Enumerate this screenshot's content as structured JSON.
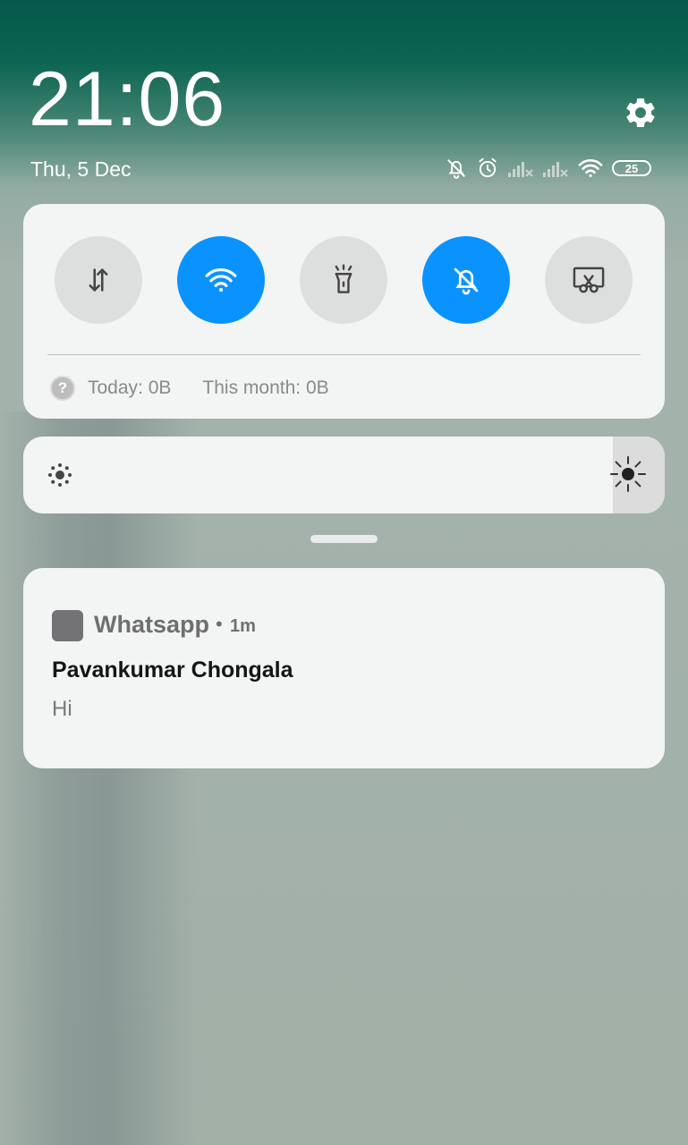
{
  "status": {
    "time": "21:06",
    "date": "Thu, 5 Dec",
    "battery": "25",
    "icons": [
      "bell-off-icon",
      "alarm-icon",
      "signal-off-icon",
      "signal-off-icon",
      "wifi-icon"
    ]
  },
  "header": {
    "settings_icon": "gear-icon"
  },
  "quick_settings": {
    "toggles": [
      {
        "name": "mobile-data",
        "icon": "data-arrows-icon",
        "state": "off"
      },
      {
        "name": "wifi",
        "icon": "wifi-icon",
        "state": "on"
      },
      {
        "name": "flashlight",
        "icon": "flashlight-icon",
        "state": "off"
      },
      {
        "name": "silent",
        "icon": "bell-off-icon",
        "state": "on"
      },
      {
        "name": "screenshot",
        "icon": "scissors-icon",
        "state": "off"
      }
    ],
    "usage_today": "Today: 0B",
    "usage_month": "This month: 0B",
    "help_glyph": "?"
  },
  "brightness": {
    "level": 0.94
  },
  "notification": {
    "app_name": "Whatsapp",
    "separator": "•",
    "time": "1m",
    "sender": "Pavankumar Chongala",
    "message": "Hi"
  },
  "colors": {
    "accent": "#0a93ff",
    "toggle_off": "#dddede",
    "card": "#f3f4f4"
  }
}
